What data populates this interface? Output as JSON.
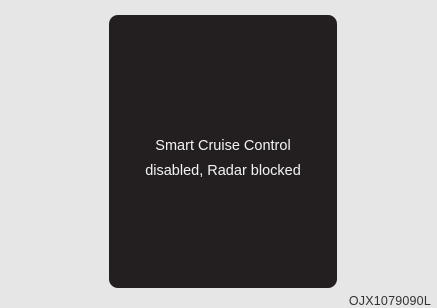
{
  "display": {
    "message_line1": "Smart Cruise Control",
    "message_line2": "disabled, Radar blocked"
  },
  "figure_code": "OJX1079090L",
  "colors": {
    "page_background": "#e6e6e6",
    "panel_background": "#231f20",
    "message_text": "#f2f2f2"
  }
}
